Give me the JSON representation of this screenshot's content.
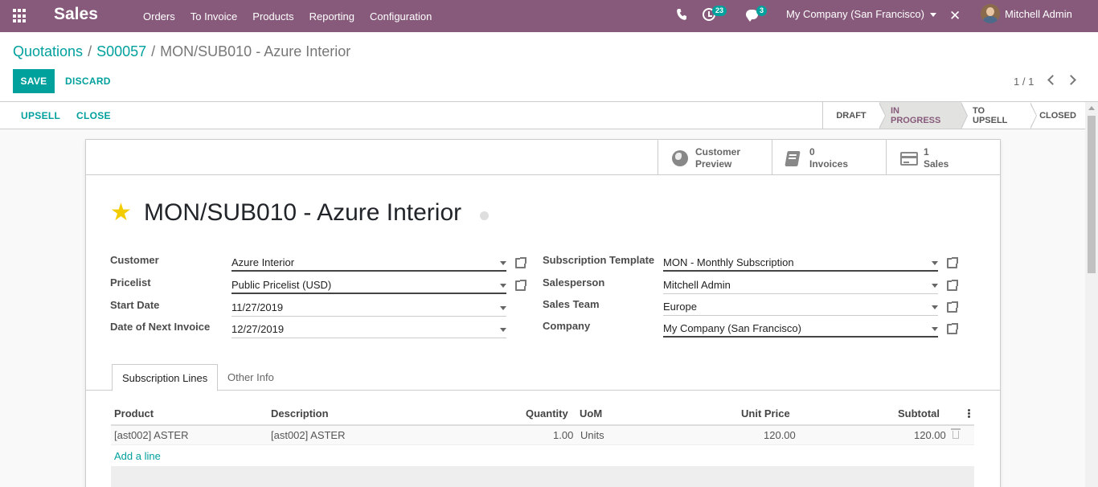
{
  "navbar": {
    "app_name": "Sales",
    "menu": [
      "Orders",
      "To Invoice",
      "Products",
      "Reporting",
      "Configuration"
    ],
    "activity_count": "23",
    "messages_count": "3",
    "company": "My Company (San Francisco)",
    "user": "Mitchell Admin",
    "accent": "#875a7b"
  },
  "breadcrumb": {
    "root": "Quotations",
    "sep": "/",
    "parent": "S00057",
    "current": "MON/SUB010 - Azure Interior"
  },
  "toolbar": {
    "save_label": "SAVE",
    "discard_label": "DISCARD",
    "pager": "1 / 1"
  },
  "statusbar": {
    "upsell_label": "UPSELL",
    "close_label": "CLOSE",
    "stages": [
      {
        "label": "DRAFT",
        "active": false
      },
      {
        "label": "IN PROGRESS",
        "active": true
      },
      {
        "label": "TO UPSELL",
        "active": false
      },
      {
        "label": "CLOSED",
        "active": false
      }
    ]
  },
  "smart_buttons": [
    {
      "icon": "globe-icon",
      "line1": "Customer",
      "line2": "Preview"
    },
    {
      "icon": "book-icon",
      "line1": "0",
      "line2": "Invoices"
    },
    {
      "icon": "card-icon",
      "line1": "1",
      "line2": "Sales"
    }
  ],
  "record": {
    "title": "MON/SUB010 - Azure Interior"
  },
  "fields_left": [
    {
      "label": "Customer",
      "value": "Azure Interior",
      "required": true,
      "external": true
    },
    {
      "label": "Pricelist",
      "value": "Public Pricelist (USD)",
      "required": true,
      "external": true
    },
    {
      "label": "Start Date",
      "value": "11/27/2019",
      "required": false,
      "external": false
    },
    {
      "label": "Date of Next Invoice",
      "value": "12/27/2019",
      "required": false,
      "external": false
    }
  ],
  "fields_right": [
    {
      "label": "Subscription Template",
      "value": "MON - Monthly Subscription",
      "required": true,
      "external": true
    },
    {
      "label": "Salesperson",
      "value": "Mitchell Admin",
      "required": false,
      "external": true
    },
    {
      "label": "Sales Team",
      "value": "Europe",
      "required": false,
      "external": true
    },
    {
      "label": "Company",
      "value": "My Company (San Francisco)",
      "required": true,
      "external": true
    }
  ],
  "tabs": [
    {
      "label": "Subscription Lines",
      "active": true
    },
    {
      "label": "Other Info",
      "active": false
    }
  ],
  "lines": {
    "headers": {
      "product": "Product",
      "description": "Description",
      "quantity": "Quantity",
      "uom": "UoM",
      "unit_price": "Unit Price",
      "subtotal": "Subtotal"
    },
    "rows": [
      {
        "product": "[ast002] ASTER",
        "description": "[ast002] ASTER",
        "quantity": "1.00",
        "uom": "Units",
        "unit_price": "120.00",
        "subtotal": "120.00"
      }
    ],
    "add_line": "Add a line"
  }
}
